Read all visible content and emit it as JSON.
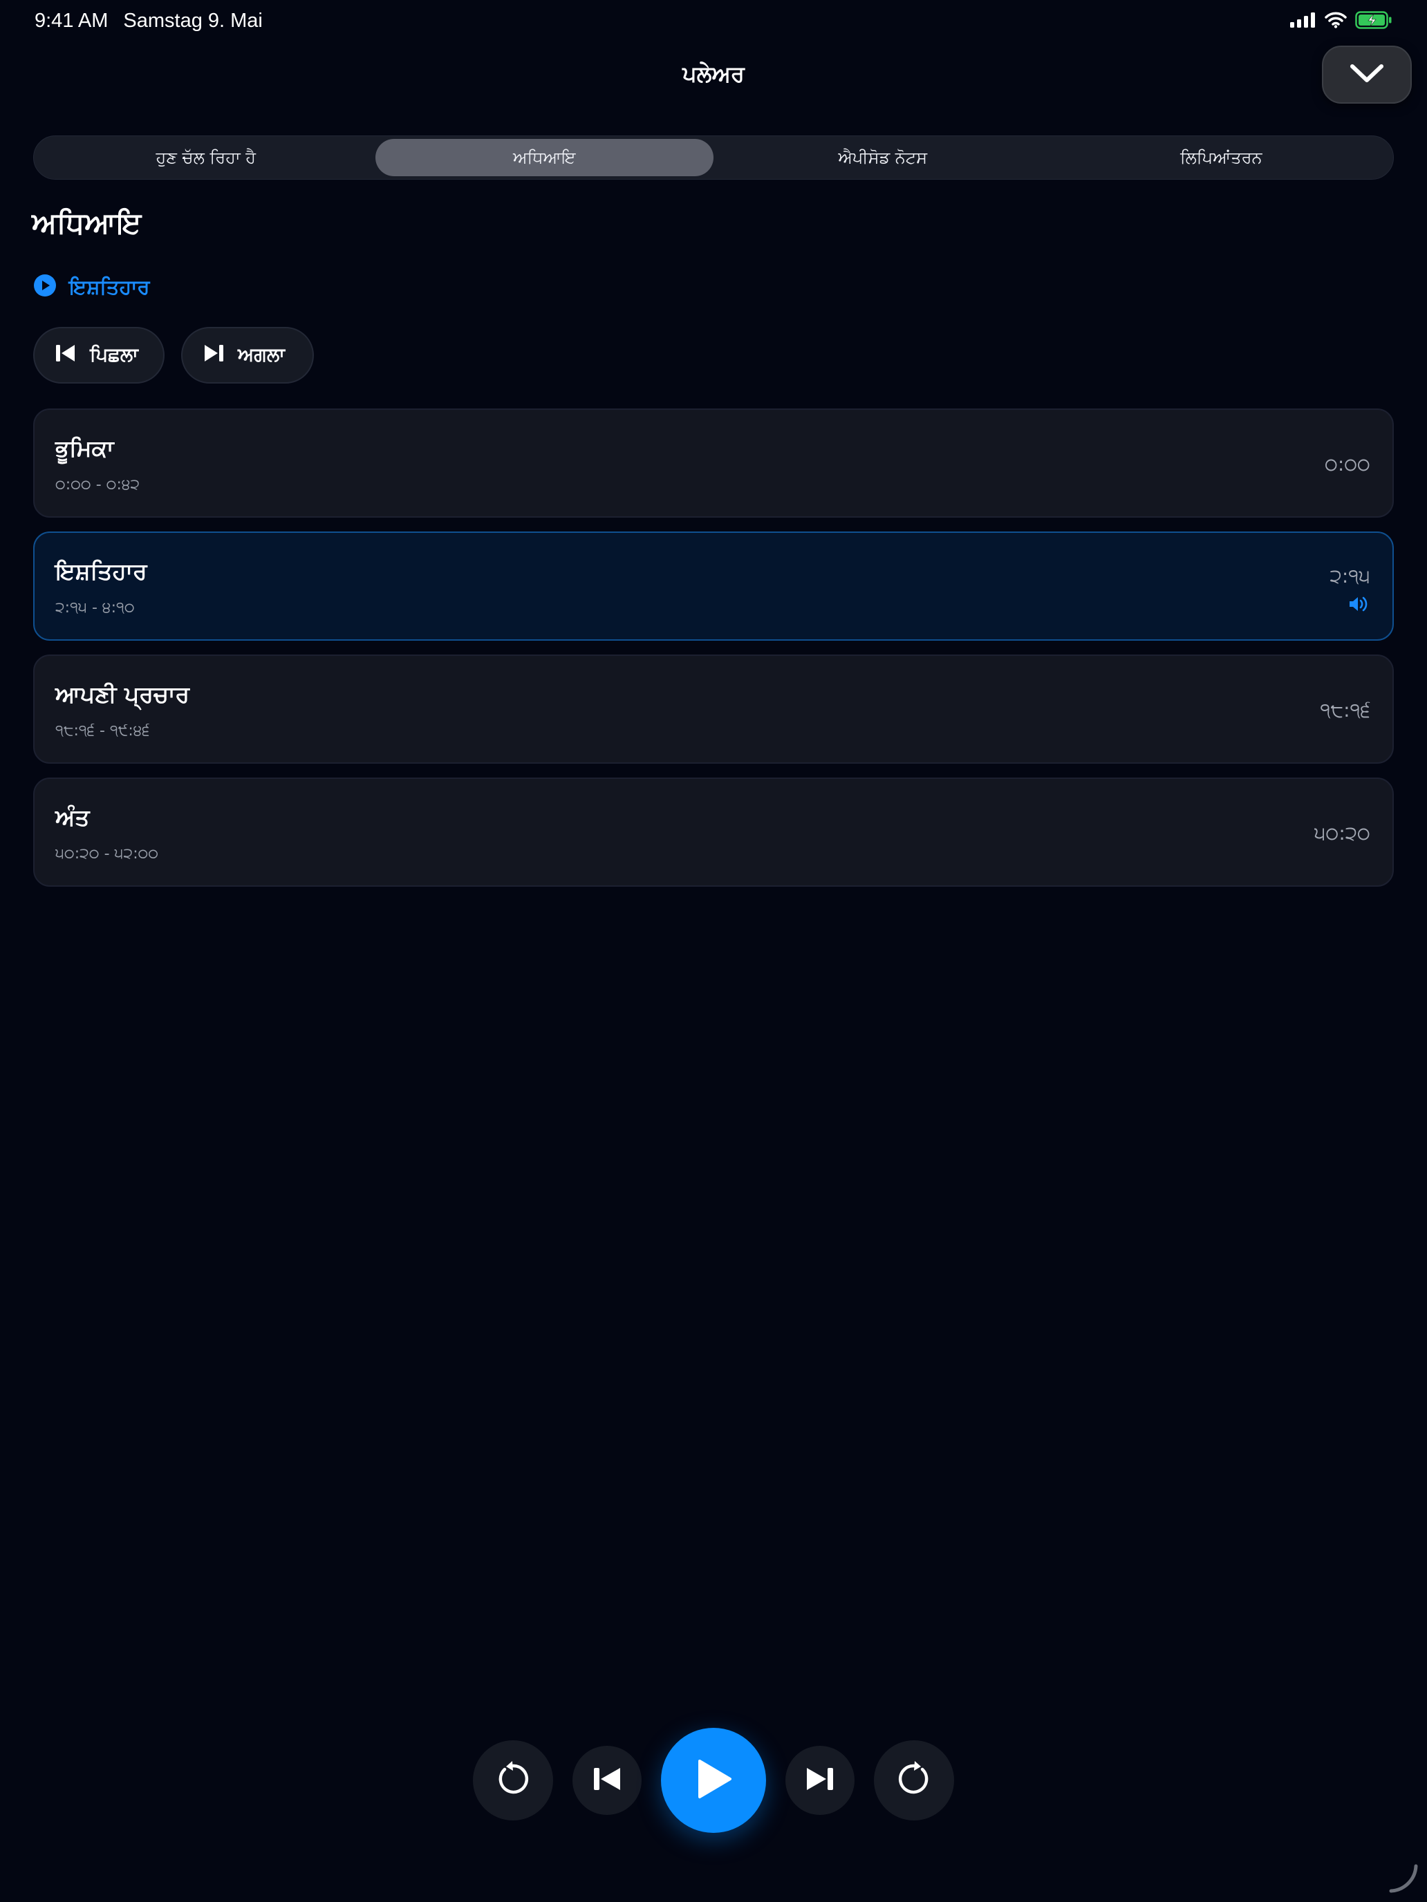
{
  "status_bar": {
    "time": "9:41 AM",
    "date": "Samstag 9. Mai",
    "icons": [
      "cellular-icon",
      "wifi-icon",
      "battery-charging-icon"
    ],
    "battery_color": "#34c759"
  },
  "header": {
    "title": "ਪਲੇਅਰ",
    "collapse_icon": "chevron-down-icon"
  },
  "tabs": [
    {
      "label": "ਹੁਣ ਚੱਲ ਰਿਹਾ ਹੈ",
      "active": false
    },
    {
      "label": "ਅਧਿਆਇ",
      "active": true
    },
    {
      "label": "ਐਪੀਸੋਡ ਨੋਟਸ",
      "active": false
    },
    {
      "label": "ਲਿਪਿਆਂਤਰਨ",
      "active": false
    }
  ],
  "section": {
    "title": "ਅਧਿਆਇ",
    "now_playing_label": "ਇਸ਼ਤਿਹਾਰ",
    "now_playing_icon": "play-circle-icon"
  },
  "nav": {
    "previous_label": "ਪਿਛਲਾ",
    "next_label": "ਅਗਲਾ"
  },
  "chapters": [
    {
      "title": "ਭੂਮਿਕਾ",
      "range": "੦:੦੦ - ੦:੪੨",
      "start": "੦:੦੦",
      "active": false
    },
    {
      "title": "ਇਸ਼ਤਿਹਾਰ",
      "range": "੨:੧੫ - ੪:੧੦",
      "start": "੨:੧੫",
      "active": true
    },
    {
      "title": "ਆਪਣੀ ਪ੍ਰਚਾਰ",
      "range": "੧੮:੧੬ - ੧੯:੪੬",
      "start": "੧੮:੧੬",
      "active": false
    },
    {
      "title": "ਅੰਤ",
      "range": "੫੦:੨੦ - ੫੨:੦੦",
      "start": "੫੦:੨੦",
      "active": false
    }
  ],
  "transport": {
    "icons": [
      "skip-back-icon",
      "previous-chapter-icon",
      "play-icon",
      "next-chapter-icon",
      "skip-forward-icon"
    ]
  },
  "colors": {
    "accent": "#0a8dff",
    "background": "#030612",
    "active_chapter_bg": "#04152d"
  }
}
